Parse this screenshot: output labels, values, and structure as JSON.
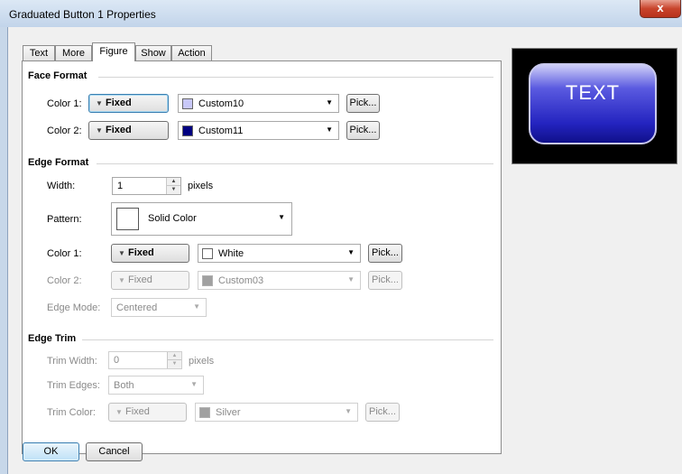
{
  "window": {
    "title": "Graduated Button 1 Properties",
    "close_label": "x"
  },
  "tabs": [
    "Text",
    "More",
    "Figure",
    "Show",
    "Action"
  ],
  "active_tab": "Figure",
  "face_format": {
    "header": "Face Format",
    "color1": {
      "label": "Color 1:",
      "mode": "Fixed",
      "value": "Custom10",
      "swatch": "#c8c8f8",
      "pick": "Pick..."
    },
    "color2": {
      "label": "Color 2:",
      "mode": "Fixed",
      "value": "Custom11",
      "swatch": "#000080",
      "pick": "Pick..."
    }
  },
  "edge_format": {
    "header": "Edge Format",
    "width": {
      "label": "Width:",
      "value": "1",
      "unit": "pixels"
    },
    "pattern": {
      "label": "Pattern:",
      "value": "Solid Color"
    },
    "color1": {
      "label": "Color 1:",
      "mode": "Fixed",
      "value": "White",
      "swatch": "#ffffff",
      "pick": "Pick..."
    },
    "color2": {
      "label": "Color 2:",
      "mode": "Fixed",
      "value": "Custom03",
      "swatch": "#a0a0a0",
      "pick": "Pick..."
    },
    "edge_mode": {
      "label": "Edge Mode:",
      "value": "Centered"
    }
  },
  "edge_trim": {
    "header": "Edge Trim",
    "trim_width": {
      "label": "Trim Width:",
      "value": "0",
      "unit": "pixels"
    },
    "trim_edges": {
      "label": "Trim Edges:",
      "value": "Both"
    },
    "trim_color": {
      "label": "Trim Color:",
      "mode": "Fixed",
      "value": "Silver",
      "swatch": "#a0a0a0",
      "pick": "Pick..."
    }
  },
  "preview": {
    "text": "TEXT"
  },
  "footer": {
    "ok": "OK",
    "cancel": "Cancel"
  }
}
